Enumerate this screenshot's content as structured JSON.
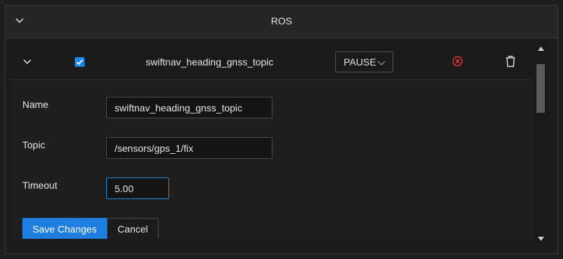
{
  "panel": {
    "title": "ROS"
  },
  "topic_item": {
    "enabled": true,
    "title": "swiftnav_heading_gnss_topic",
    "pause_label": "PAUSE",
    "status_color": "#e53935"
  },
  "form": {
    "name_label": "Name",
    "name_value": "swiftnav_heading_gnss_topic",
    "topic_label": "Topic",
    "topic_value": "/sensors/gps_1/fix",
    "timeout_label": "Timeout",
    "timeout_value": "5.00",
    "save_label": "Save Changes",
    "cancel_label": "Cancel"
  },
  "icons": {
    "panel_collapse": "chevron-down-icon",
    "row_collapse": "chevron-down-icon",
    "pause_caret": "chevron-down-icon",
    "status": "error-circle-icon",
    "delete": "trash-icon"
  },
  "colors": {
    "accent": "#1e88e5",
    "error": "#e53935"
  }
}
